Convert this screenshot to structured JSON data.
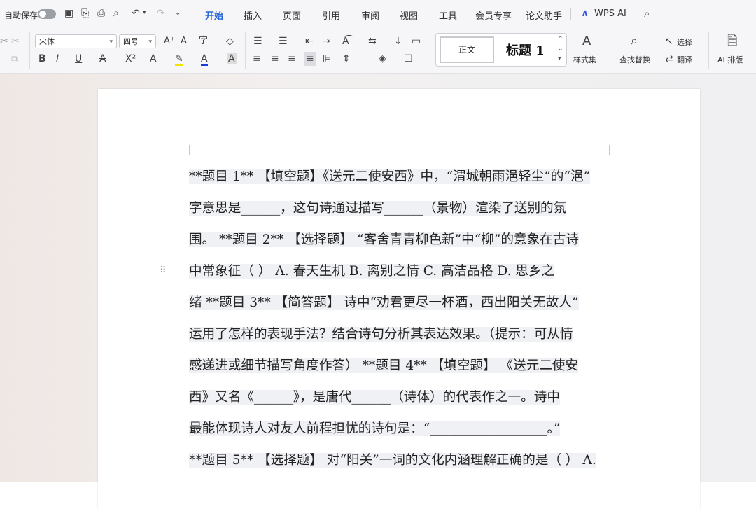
{
  "titlebar": {
    "autosave_label": "自动保存",
    "tabs": [
      "开始",
      "插入",
      "页面",
      "引用",
      "审阅",
      "视图",
      "工具",
      "会员专享",
      "论文助手"
    ],
    "active_tab": "开始",
    "wps_ai_label": "WPS AI"
  },
  "ribbon": {
    "font_name": "宋体",
    "font_size": "四号",
    "style_normal": "正文",
    "style_heading": "标题 1",
    "style_set_label": "样式集",
    "find_replace_label": "查找替换",
    "select_label": "选择",
    "translate_label": "翻译",
    "ai_layout_label": "AI 排版"
  },
  "document": {
    "lines": [
      "**题目 1** 【填空题】《送元二使安西》中，“渭城朝雨浥轻尘”的“浥”",
      "字意思是______，这句诗通过描写______（景物）渲染了送别的氛",
      "围。 **题目 2** 【选择题】 “客舍青青柳色新”中“柳”的意象在古诗",
      "中常象征（ ） A. 春天生机 B. 离别之情 C. 高洁品格 D. 思乡之",
      "绪 **题目 3** 【简答题】 诗中“劝君更尽一杯酒，西出阳关无故人”",
      "运用了怎样的表现手法？结合诗句分析其表达效果。（提示：可从情",
      "感递进或细节描写角度作答） **题目 4** 【填空题】 《送元二使安",
      "西》又名《______》，是唐代______（诗体）的代表作之一。诗中",
      "最能体现诗人对友人前程担忧的诗句是：“__________________。”",
      "**题目 5** 【选择题】 对“阳关”一词的文化内涵理解正确的是（ ） A."
    ]
  }
}
